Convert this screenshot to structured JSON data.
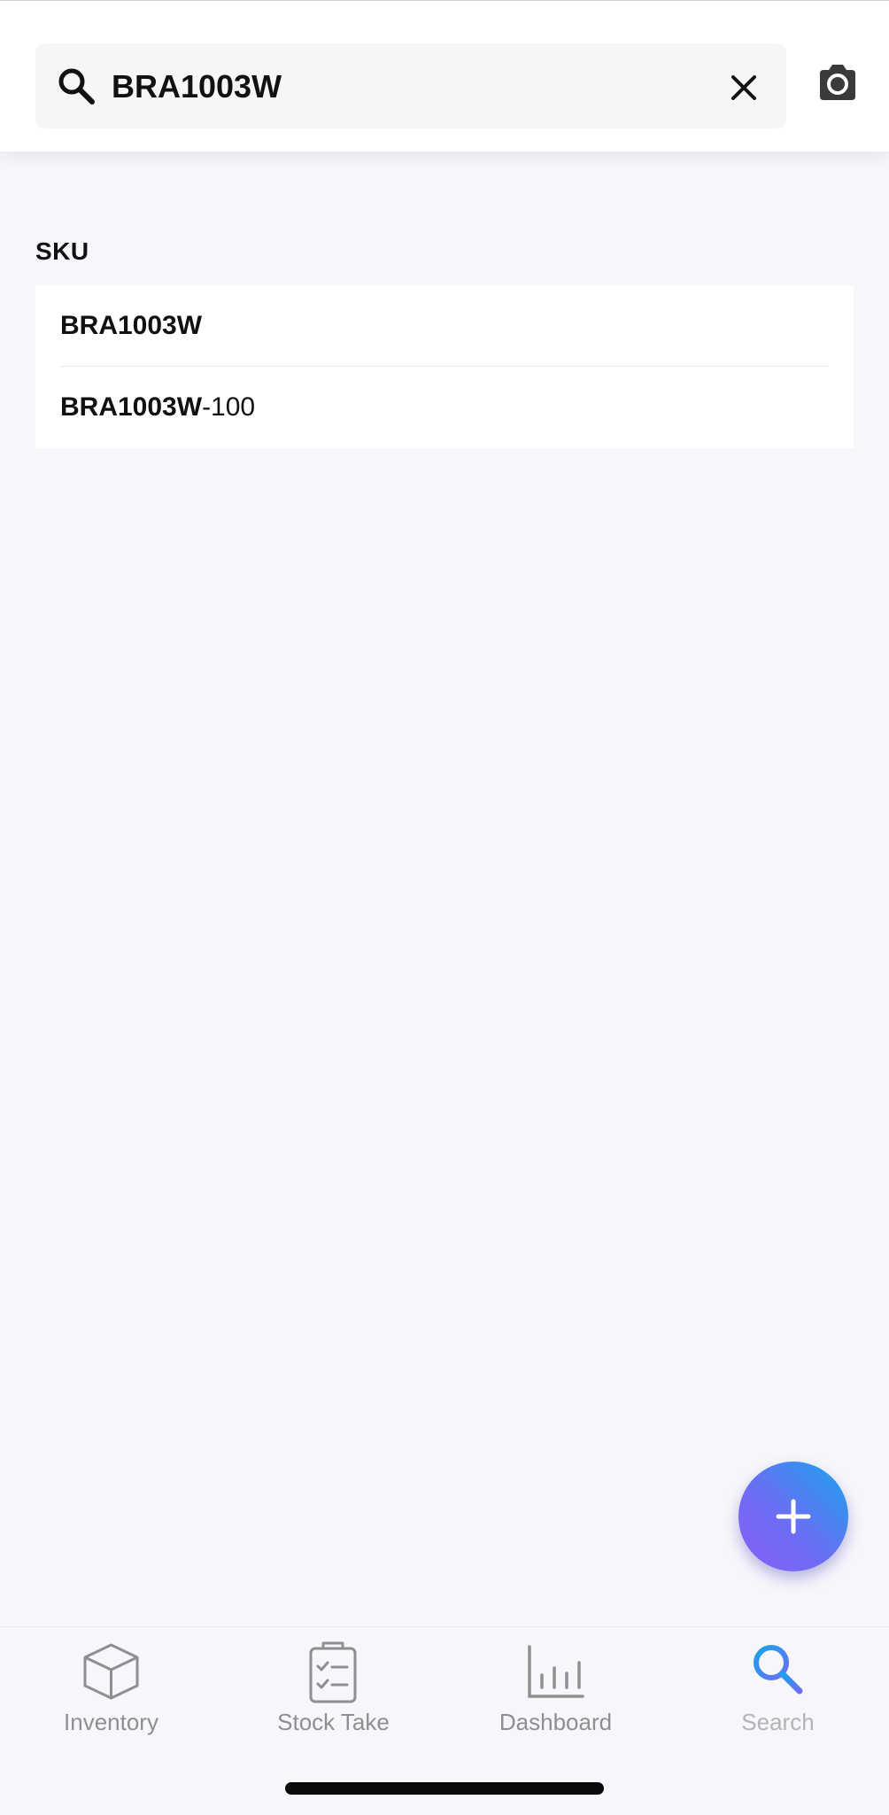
{
  "search": {
    "value": "BRA1003W",
    "icon": "search-icon",
    "clear_icon": "close-icon",
    "camera_icon": "camera-icon"
  },
  "results": {
    "section_label": "SKU",
    "items": [
      {
        "match": "BRA1003W",
        "suffix": ""
      },
      {
        "match": "BRA1003W",
        "suffix": "-100"
      }
    ]
  },
  "fab": {
    "icon": "plus-icon"
  },
  "tabs": [
    {
      "label": "Inventory",
      "icon": "cube-icon",
      "active": false
    },
    {
      "label": "Stock Take",
      "icon": "clipboard-check-icon",
      "active": false
    },
    {
      "label": "Dashboard",
      "icon": "bar-chart-icon",
      "active": false
    },
    {
      "label": "Search",
      "icon": "search-icon",
      "active": true
    }
  ],
  "colors": {
    "accent": "#3b8ae6",
    "fab_gradient_start": "#1aa3ee",
    "fab_gradient_end": "#8a5ef5",
    "tab_inactive": "#8f8f8f",
    "background": "#f6f6fb"
  }
}
